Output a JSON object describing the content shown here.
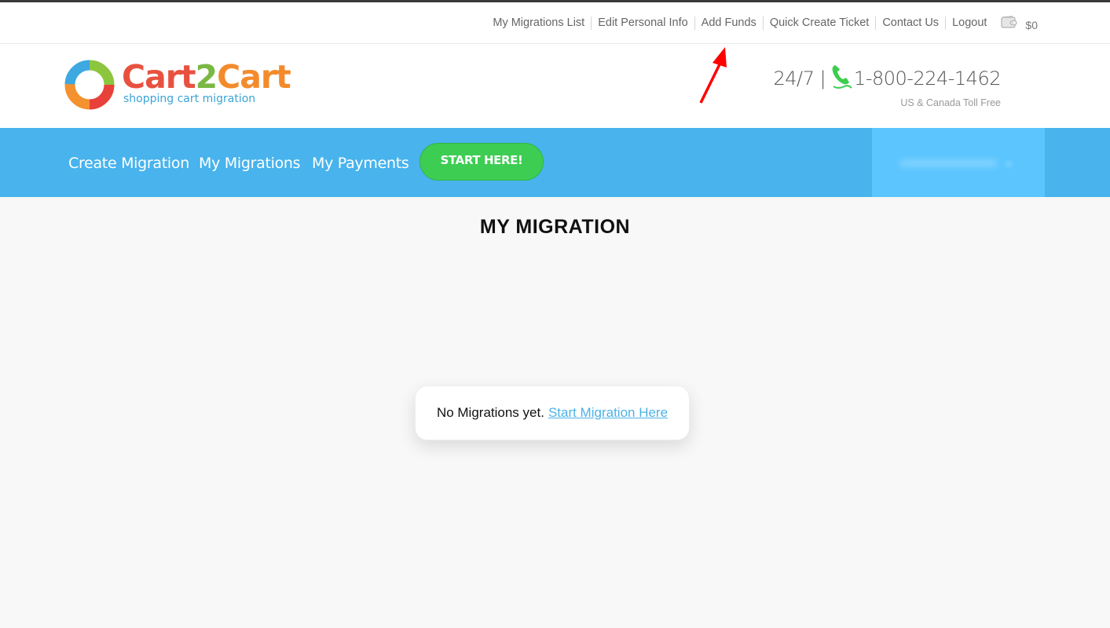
{
  "utility_nav": {
    "links": [
      {
        "label": "My Migrations List"
      },
      {
        "label": "Edit Personal Info"
      },
      {
        "label": "Add Funds"
      },
      {
        "label": "Quick Create Ticket"
      },
      {
        "label": "Contact Us"
      },
      {
        "label": "Logout"
      }
    ],
    "wallet_icon": "wallet-icon",
    "balance": "$0"
  },
  "header": {
    "logo": {
      "word_part1": "Cart",
      "word_part2": "2",
      "word_part3": "Cart",
      "tagline": "shopping cart migration"
    },
    "support": {
      "hours": "24/7 |",
      "phone_icon": "phone-icon",
      "phone": "1-800-224-1462",
      "note": "US & Canada Toll Free"
    }
  },
  "main_nav": {
    "items": [
      {
        "label": "Create Migration"
      },
      {
        "label": "My Migrations"
      },
      {
        "label": "My Payments"
      }
    ],
    "cta_label": "START HERE!",
    "user_menu": "redacted"
  },
  "content": {
    "title": "MY MIGRATION",
    "empty_message": "No Migrations yet.",
    "empty_link": "Start Migration Here"
  },
  "colors": {
    "nav_bg": "#48b3ec",
    "cta_green": "#3dcd52",
    "link_blue": "#4cb2e8",
    "annotation_red": "#ff0000"
  }
}
